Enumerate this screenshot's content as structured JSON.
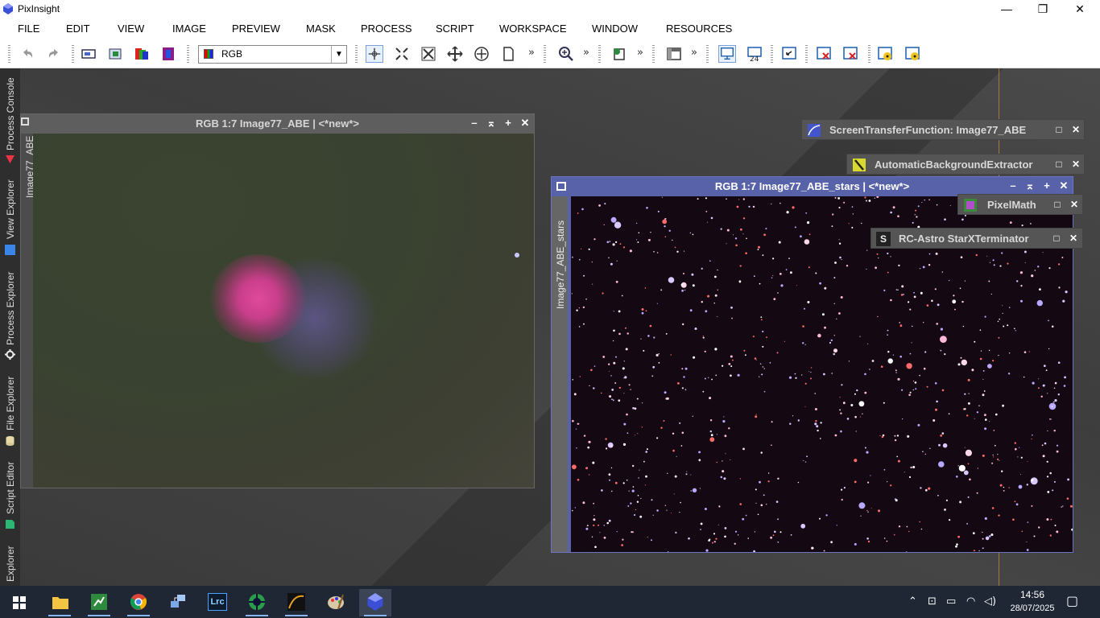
{
  "app": {
    "title": "PixInsight"
  },
  "window_controls": {
    "minimize": "—",
    "maximize": "❐",
    "close": "✕"
  },
  "menu": [
    "FILE",
    "EDIT",
    "VIEW",
    "IMAGE",
    "PREVIEW",
    "MASK",
    "PROCESS",
    "SCRIPT",
    "WORKSPACE",
    "WINDOW",
    "RESOURCES"
  ],
  "toolbar": {
    "channel_select": "RGB",
    "more": "»"
  },
  "left_explorers": [
    "Process Console",
    "View Explorer",
    "Process Explorer",
    "File Explorer",
    "Script Editor",
    "Explorer"
  ],
  "image_windows": [
    {
      "title": "RGB 1:7 Image77_ABE | <*new*>",
      "side_label": "Image77_ABE"
    },
    {
      "title": "RGB 1:7 Image77_ABE_stars | <*new*>",
      "side_label": "Image77_ABE_stars"
    }
  ],
  "process_icons": [
    "ScreenTransferFunction: Image77_ABE",
    "AutomaticBackgroundExtractor",
    "PixelMath",
    "RC-Astro StarXTerminator"
  ],
  "process_icon_glyphs": {
    "starx": "S"
  },
  "taskbar": {
    "apps": [
      "windows-start",
      "file-explorer",
      "spreadsheet-app",
      "chrome",
      "network-app",
      "lightroom-classic",
      "green-app",
      "curves-app",
      "paint-app",
      "pixinsight"
    ],
    "lightroom_label": "Lrc",
    "clock_time": "14:56",
    "clock_date": "28/07/2025"
  },
  "colors": {
    "active_window": "#5862a8",
    "inactive_window": "#5e5e5e",
    "taskbar": "#1f2735"
  }
}
